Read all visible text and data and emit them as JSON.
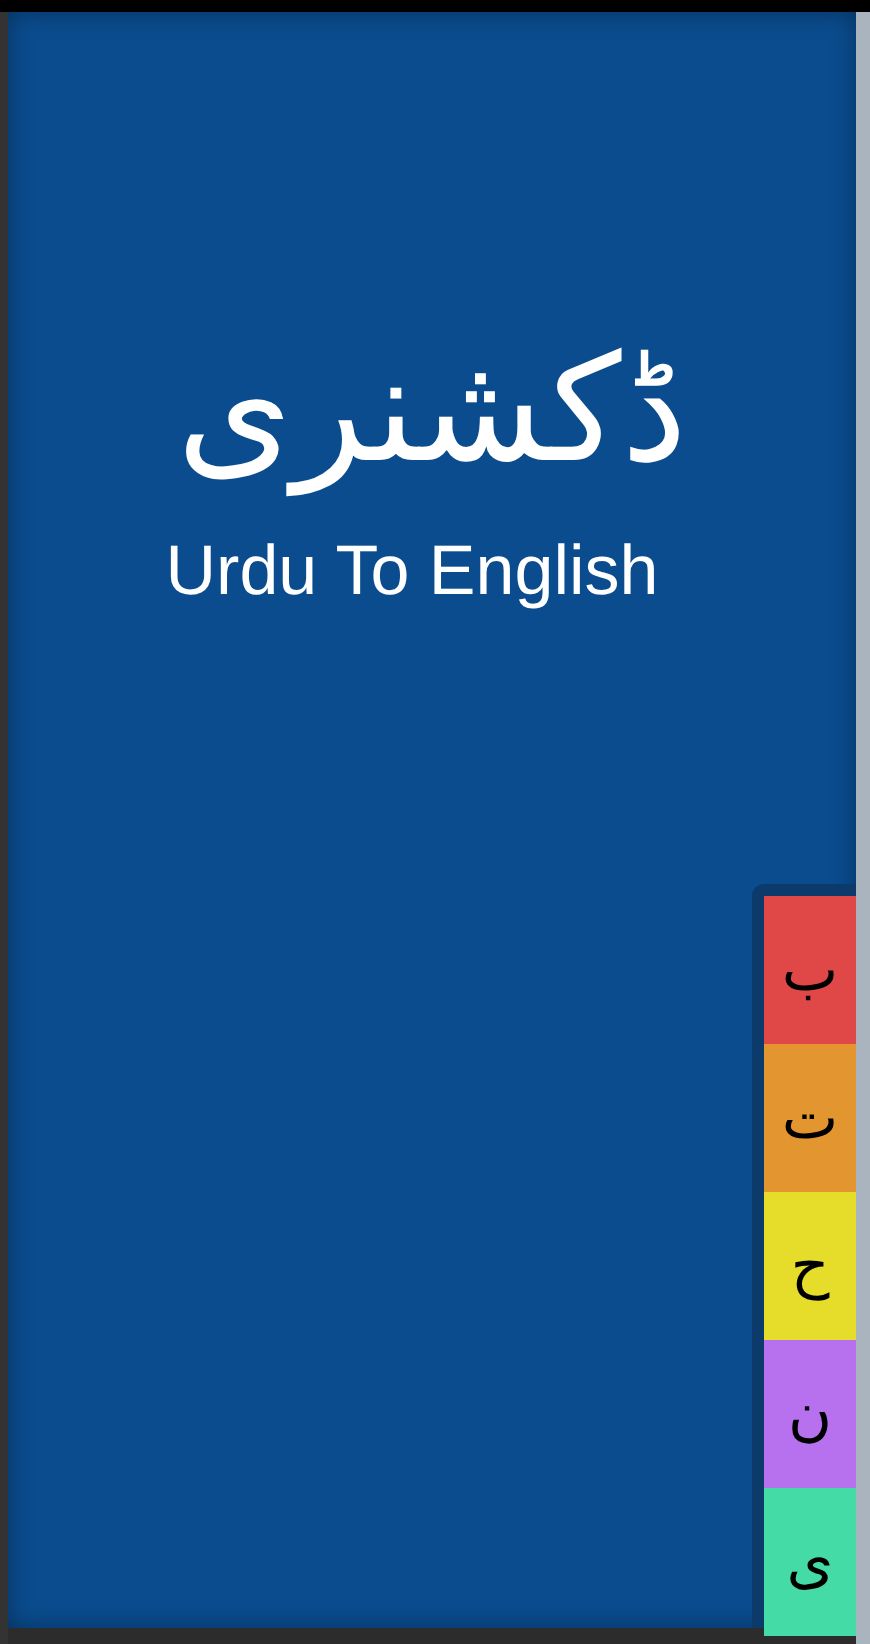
{
  "title": "ڈکشنری",
  "subtitle": "Urdu To English",
  "letters": [
    {
      "label": "ب",
      "color": "#e04848"
    },
    {
      "label": "ت",
      "color": "#e39530"
    },
    {
      "label": "ح",
      "color": "#e6dc2a"
    },
    {
      "label": "ن",
      "color": "#b771ee"
    },
    {
      "label": "ی",
      "color": "#44dba6"
    }
  ]
}
